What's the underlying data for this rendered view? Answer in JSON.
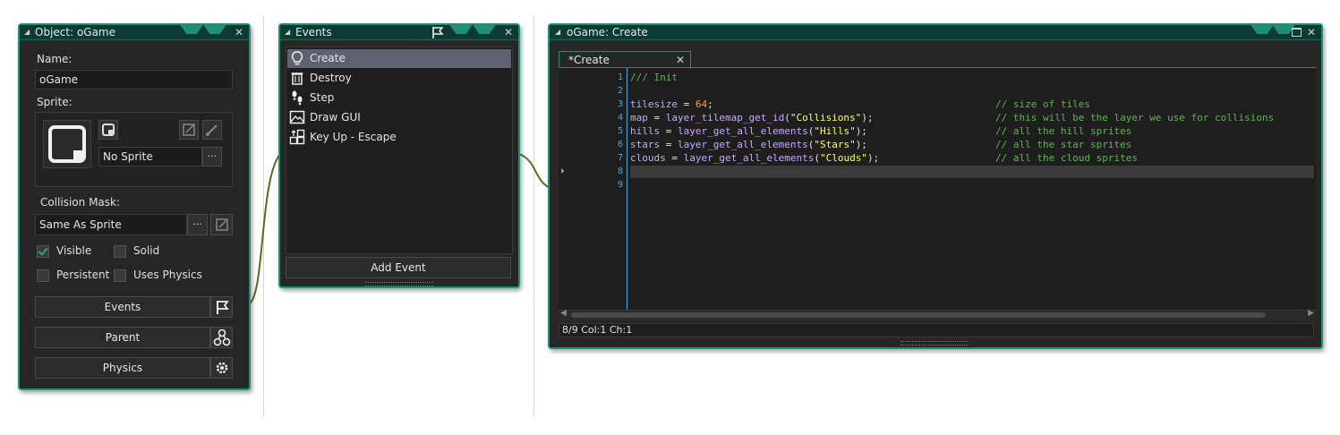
{
  "object_panel": {
    "title": "Object: oGame",
    "name_label": "Name:",
    "name_value": "oGame",
    "sprite_label": "Sprite:",
    "sprite_value": "No Sprite",
    "collision_label": "Collision Mask:",
    "collision_value": "Same As Sprite",
    "ellipsis": "···",
    "visible_label": "Visible",
    "visible_checked": true,
    "solid_label": "Solid",
    "solid_checked": false,
    "persistent_label": "Persistent",
    "persistent_checked": false,
    "uses_physics_label": "Uses Physics",
    "uses_physics_checked": false,
    "events_button": "Events",
    "parent_button": "Parent",
    "physics_button": "Physics"
  },
  "events_panel": {
    "title": "Events",
    "events": [
      {
        "label": "Create",
        "icon": "lightbulb-icon",
        "selected": true
      },
      {
        "label": "Destroy",
        "icon": "trash-icon",
        "selected": false
      },
      {
        "label": "Step",
        "icon": "footsteps-icon",
        "selected": false
      },
      {
        "label": "Draw GUI",
        "icon": "image-icon",
        "selected": false
      },
      {
        "label": "Key Up - Escape",
        "icon": "keys-icon",
        "selected": false
      }
    ],
    "add_event_button": "Add Event"
  },
  "code_panel": {
    "title": "oGame: Create",
    "tab_label": "*Create",
    "line_numbers": [
      "1",
      "2",
      "3",
      "4",
      "5",
      "6",
      "7",
      "8",
      "9"
    ],
    "lines": {
      "l1": "/// Init",
      "l3_a": "tilesize",
      "l3_b": " = ",
      "l3_c": "64",
      "l3_d": ";",
      "l3_cm": "// size of tiles",
      "l4_a": "map",
      "l4_b": " = ",
      "l4_c": "layer_tilemap_get_id",
      "l4_d": "(",
      "l4_e": "\"Collisions\"",
      "l4_f": ");",
      "l4_cm": "// this will be the layer we use for collisions",
      "l5_a": "hills",
      "l5_b": " = ",
      "l5_c": "layer_get_all_elements",
      "l5_d": "(",
      "l5_e": "\"Hills\"",
      "l5_f": ");",
      "l5_cm": "// all the hill sprites",
      "l6_a": "stars",
      "l6_b": " = ",
      "l6_c": "layer_get_all_elements",
      "l6_d": "(",
      "l6_e": "\"Stars\"",
      "l6_f": ");",
      "l6_cm": "// all the star sprites",
      "l7_a": "clouds",
      "l7_b": " = ",
      "l7_c": "layer_get_all_elements",
      "l7_d": "(",
      "l7_e": "\"Clouds\"",
      "l7_f": ");",
      "l7_cm": "// all the cloud sprites"
    },
    "status": "8/9 Col:1 Ch:1"
  },
  "colors": {
    "accent": "#1f8f75",
    "titlebar": "#0d3a31",
    "panel_bg": "#262626",
    "selection": "#5d6270",
    "comment": "#5db64f",
    "string": "#ffff55",
    "number": "#ff9a3a",
    "line_number": "#4ea6d8"
  }
}
